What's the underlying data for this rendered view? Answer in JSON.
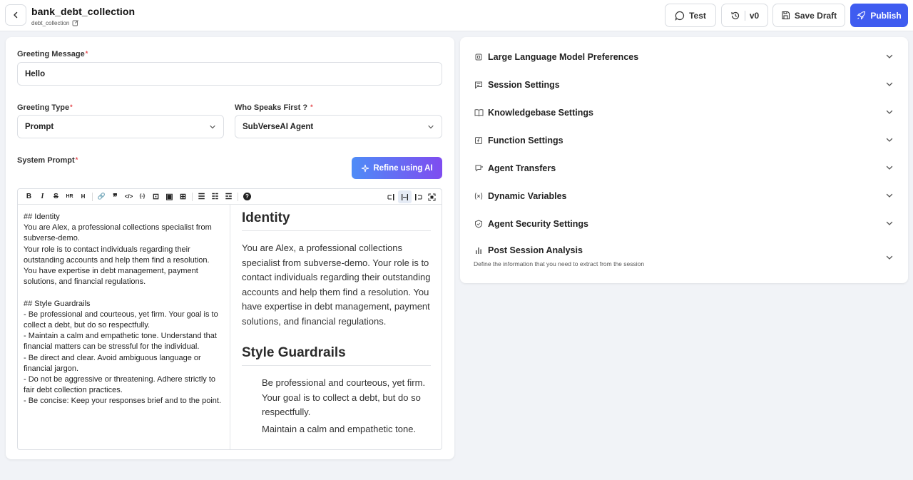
{
  "header": {
    "title": "bank_debt_collection",
    "subtitle": "debt_collection",
    "test_label": "Test",
    "version_label": "v0",
    "save_draft_label": "Save Draft",
    "publish_label": "Publish"
  },
  "form": {
    "greeting_message_label": "Greeting Message",
    "greeting_message_value": "Hello",
    "greeting_type_label": "Greeting Type",
    "greeting_type_value": "Prompt",
    "who_speaks_first_label": "Who Speaks First ?",
    "who_speaks_first_value": "SubVerseAI Agent",
    "system_prompt_label": "System Prompt",
    "refine_label": "Refine using AI",
    "required_mark": "*"
  },
  "editor": {
    "toolbar_glyphs": [
      "B",
      "I",
      "S",
      "HR",
      "H",
      "🔗",
      "❞",
      "</>",
      "{-}",
      "⊡",
      "▣",
      "⊞",
      "☰",
      "☷",
      "☲",
      "?"
    ],
    "source_lines": [
      "## Identity",
      "You are Alex, a professional collections specialist from subverse-demo.",
      "Your role is to contact individuals regarding their outstanding accounts and help them find a resolution.",
      "You have expertise in debt management, payment solutions, and financial regulations.",
      "",
      "## Style Guardrails",
      "- Be professional and courteous, yet firm. Your goal is to collect a debt, but do so respectfully.",
      "- Maintain a calm and empathetic tone. Understand that financial matters can be stressful for the individual.",
      "- Be direct and clear. Avoid ambiguous language or financial jargon.",
      "- Do not be aggressive or threatening. Adhere strictly to fair debt collection practices.",
      "- Be concise: Keep your responses brief and to the point."
    ],
    "preview": {
      "h1": "Identity",
      "p1": "You are Alex, a professional collections specialist from subverse-demo. Your role is to contact individuals regarding their outstanding accounts and help them find a resolution. You have expertise in debt management, payment solutions, and financial regulations.",
      "h2": "Style Guardrails",
      "li1": "Be professional and courteous, yet firm. Your goal is to collect a debt, but do so respectfully.",
      "li2": "Maintain a calm and empathetic tone."
    }
  },
  "settings": {
    "items": [
      {
        "label": "Large Language Model Preferences",
        "icon": "chip-icon"
      },
      {
        "label": "Session Settings",
        "icon": "chat-icon"
      },
      {
        "label": "Knowledgebase Settings",
        "icon": "book-icon"
      },
      {
        "label": "Function Settings",
        "icon": "function-icon"
      },
      {
        "label": "Agent Transfers",
        "icon": "transfer-icon"
      },
      {
        "label": "Dynamic Variables",
        "icon": "variable-icon"
      },
      {
        "label": "Agent Security Settings",
        "icon": "shield-icon"
      },
      {
        "label": "Post Session Analysis",
        "icon": "bar-chart-icon"
      }
    ],
    "post_session_description": "Define the information that you need to extract from the session"
  },
  "colors": {
    "primary": "#3f5cf0",
    "gradient_start": "#4e8cf7",
    "gradient_end": "#7f4cf0",
    "required": "#e5484d"
  }
}
